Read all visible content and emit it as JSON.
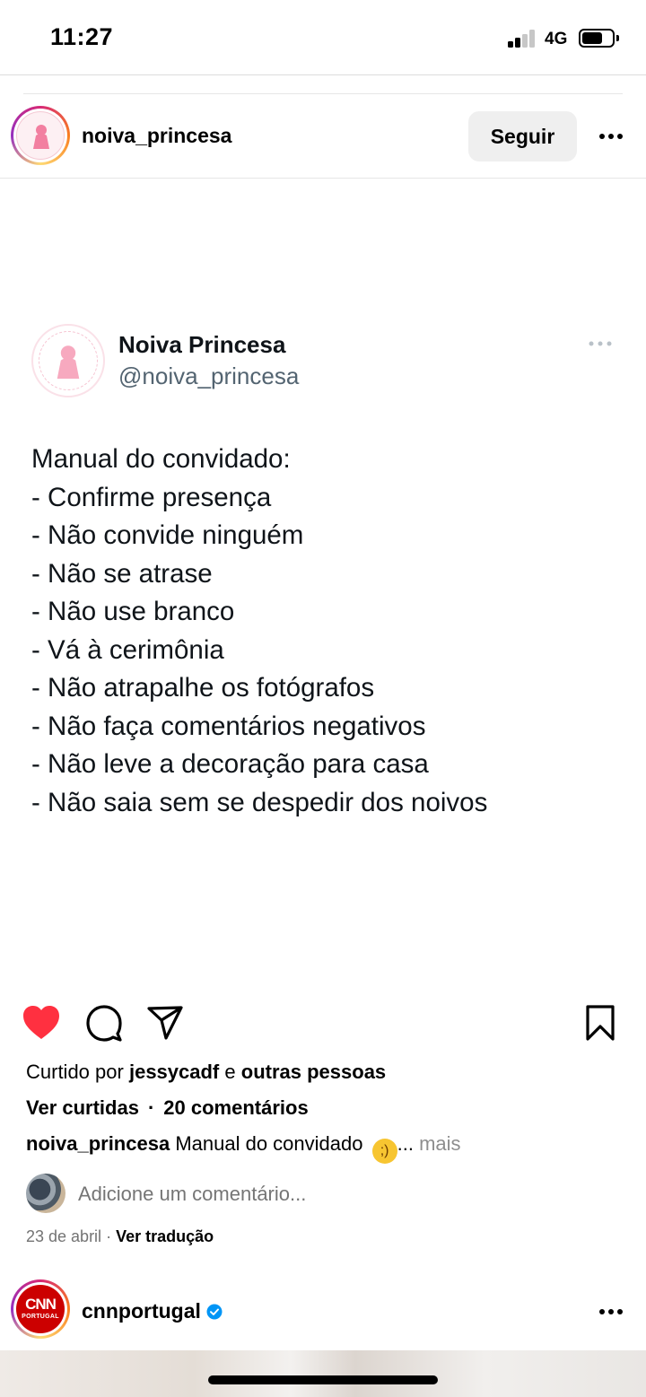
{
  "status_bar": {
    "time": "11:27",
    "network": "4G",
    "signal_bars": 2,
    "signal_bars_total": 4,
    "battery_level": 0.7
  },
  "post": {
    "username": "noiva_princesa",
    "follow_label": "Seguir",
    "tweet": {
      "display_name": "Noiva Princesa",
      "handle": "@noiva_princesa",
      "lines": [
        "Manual do convidado:",
        "- Confirme presença",
        "- Não convide ninguém",
        "- Não se atrase",
        "- Não use branco",
        "- Vá à cerimônia",
        "- Não atrapalhe os fotógrafos",
        "- Não faça comentários negativos",
        "- Não leve a decoração para casa",
        "- Não saia sem se despedir dos noivos"
      ]
    },
    "liked": true,
    "likes": {
      "prefix": "Curtido por",
      "user": "jessycadf",
      "joiner": "e",
      "others": "outras pessoas"
    },
    "view_likes_label": "Ver curtidas",
    "comments_label": "20 comentários",
    "caption": {
      "user": "noiva_princesa",
      "text": "Manual do convidado",
      "emoji": "wink-emoji",
      "ellipsis": "...",
      "more_label": "mais"
    },
    "comment_placeholder": "Adicione um comentário...",
    "date": "23 de abril",
    "translate_label": "Ver tradução"
  },
  "next_post": {
    "username": "cnnportugal",
    "verified": true,
    "logo_text": "CNN",
    "logo_subtext": "PORTUGAL"
  },
  "colors": {
    "heart": "#ff3040",
    "verified": "#0095f6",
    "follow_bg": "#efefef",
    "secondary_text": "#8e8e8e"
  }
}
